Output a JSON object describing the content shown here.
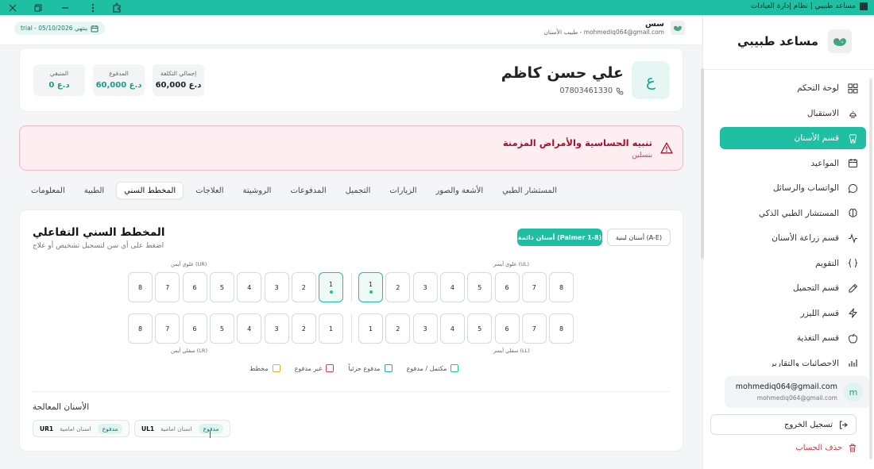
{
  "window": {
    "title": "مساعد طبيبي | نظام إدارة العيادات"
  },
  "sidebar": {
    "brand": "مساعد طبيبي",
    "items": [
      {
        "label": "لوحة التحكم",
        "icon": "grid-icon"
      },
      {
        "label": "الاستقبال",
        "icon": "bell-icon"
      },
      {
        "label": "قسم الأسنان",
        "icon": "tooth-icon"
      },
      {
        "label": "المواعيد",
        "icon": "calendar-icon"
      },
      {
        "label": "الواتساب والرسائل",
        "icon": "chat-icon"
      },
      {
        "label": "المستشار الطبي الذكي",
        "icon": "brain-icon"
      },
      {
        "label": "قسم زراعة الأسنان",
        "icon": "activity-icon"
      },
      {
        "label": "التقويم",
        "icon": "braces-icon"
      },
      {
        "label": "قسم التجميل",
        "icon": "pen-icon"
      },
      {
        "label": "قسم الليزر",
        "icon": "zap-icon"
      },
      {
        "label": "قسم التغذية",
        "icon": "apple-icon"
      },
      {
        "label": "الاحصائيات والتقارير",
        "icon": "chart-icon"
      }
    ],
    "user_name": "mohmediq064@gmail.com",
    "user_email": "mohmediq064@gmail.com",
    "user_initial": "m",
    "logout_label": "تسجيل الخروج",
    "delete_label": "حذف الحساب"
  },
  "topbar": {
    "name": "سس",
    "subtitle": "طبيب الأسنان - mohmediq064@gmail.com",
    "trial": "trial - ينتهي 05/10/2026"
  },
  "patient": {
    "initial": "ع",
    "name": "علي حسن كاظم",
    "phone": "07803461330",
    "total_label": "إجمالي التكلفة",
    "total_value": "60,000 د.ع",
    "paid_label": "المدفوع",
    "paid_value": "60,000 د.ع",
    "remain_label": "المتبقي",
    "remain_value": "0 د.ع"
  },
  "alert": {
    "title": "تنبيه الحساسية والأمراض المزمنة",
    "text": "بنسلين"
  },
  "tabs": [
    "المعلومات",
    "الطبية",
    "المخطط السني",
    "العلاجات",
    "الروشيتة",
    "المدفوعات",
    "التجميل",
    "الزيارات",
    "الأشعة والصور",
    "المستشار الطبي"
  ],
  "active_tab": "المخطط السني",
  "chart": {
    "title": "المخطط السني التفاعلي",
    "subtitle": "اضغط على أي سن لتسجيل تشخيص أو علاج",
    "btn_permanent": "أسنان دائمة (Palmer 1-8)",
    "btn_milk": "أسنان لبنية (A-E)",
    "label_ur": "علوي أيمن (UR)",
    "label_ul": "علوي أيسر (UL)",
    "label_lr": "سفلي أيمن (LR)",
    "label_ll": "سفلي أيسر (LL)",
    "upper_right": [
      "8",
      "7",
      "6",
      "5",
      "4",
      "3",
      "2",
      "1"
    ],
    "upper_left": [
      "1",
      "2",
      "3",
      "4",
      "5",
      "6",
      "7",
      "8"
    ],
    "lower_right": [
      "8",
      "7",
      "6",
      "5",
      "4",
      "3",
      "2",
      "1"
    ],
    "lower_left": [
      "1",
      "2",
      "3",
      "4",
      "5",
      "6",
      "7",
      "8"
    ],
    "treated_upper": [
      "UR1",
      "UL1"
    ],
    "legend": [
      {
        "label": "مكتمل / مدفوع",
        "color": "#1fbfa3"
      },
      {
        "label": "مدفوع جزئياً",
        "color": "#2aa7c9"
      },
      {
        "label": "غير مدفوع",
        "color": "#d8406a"
      },
      {
        "label": "مخطط",
        "color": "#e1b12c"
      }
    ],
    "treated_title": "الأسنان المعالجة",
    "treated": [
      {
        "code": "UL1",
        "desc": "اسنان امامية",
        "status": "مدفوع"
      },
      {
        "code": "UR1",
        "desc": "اسنان امامية",
        "status": "مدفوع"
      }
    ]
  }
}
